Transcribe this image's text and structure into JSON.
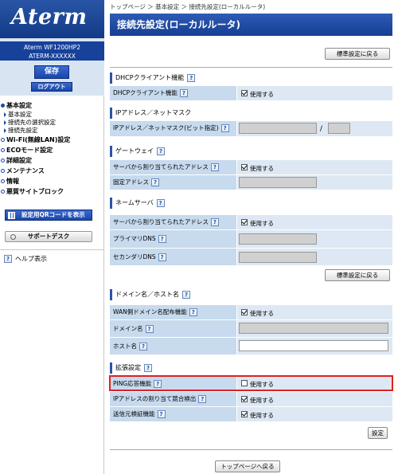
{
  "sidebar": {
    "logo": "Aterm",
    "device_model": "Aterm  WF1200HP2",
    "device_id": "ATERM-XXXXXX",
    "save_label": "保存",
    "logout_label": "ログアウト",
    "nav": {
      "basic": "基本設定",
      "basic_sub1": "基本設定",
      "basic_sub2": "接続先の選択設定",
      "basic_sub3": "接続先設定",
      "wifi": "Wi-Fi(無線LAN)設定",
      "eco": "ECOモード設定",
      "detail": "詳細設定",
      "maint": "メンテナンス",
      "info": "情報",
      "block": "悪質サイトブロック"
    },
    "qr_label": "設定用QRコードを表示",
    "support_label": "サポートデスク",
    "help_label": "ヘルプ表示"
  },
  "help_glyph": "?",
  "main": {
    "breadcrumb": "トップページ ＞ 基本設定 ＞ 接続先設定(ローカルルータ)",
    "title": "接続先設定(ローカルルータ)",
    "default_btn": "標準設定に戻る",
    "use_label": "使用する",
    "slash": "/",
    "sections": {
      "dhcp": "DHCPクライアント機能",
      "ip": "IPアドレス／ネットマスク",
      "gw": "ゲートウェイ",
      "ns": "ネームサーバ",
      "domain": "ドメイン名／ホスト名",
      "ext": "拡張設定"
    },
    "rows": {
      "dhcp_client": "DHCPクライアント機能",
      "ip_mask": "IPアドレス／ネットマスク(ビット指定)",
      "gw_assigned": "サーバから割り当てられたアドレス",
      "gw_fixed": "固定アドレス",
      "ns_assigned": "サーバから割り当てられたアドレス",
      "primary_dns": "プライマリDNS",
      "secondary_dns": "セカンダリDNS",
      "wan_domain": "WAN側ドメイン名配布機能",
      "domain_name": "ドメイン名",
      "host_name": "ホスト名",
      "ping": "PING応答機能",
      "ip_conflict": "IPアドレスの割り当て競合検出",
      "source_verify": "送信元検証機能"
    },
    "set_btn": "設定",
    "top_btn": "トップページへ戻る"
  }
}
